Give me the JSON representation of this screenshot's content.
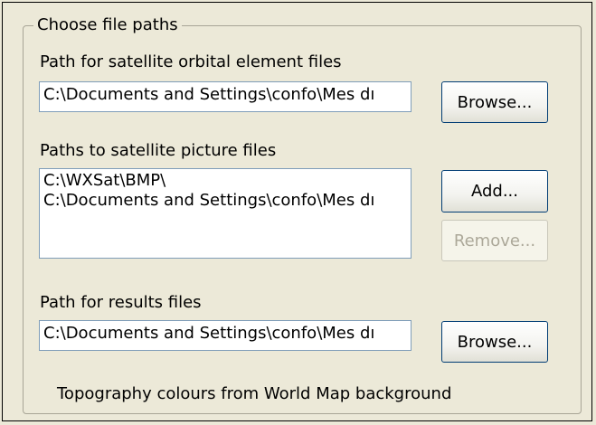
{
  "group_title": "Choose file paths",
  "orbital": {
    "label": "Path for satellite orbital element files",
    "value": "C:\\Documents and Settings\\confo\\Mes dı",
    "browse_label": "Browse..."
  },
  "pictures": {
    "label": "Paths to satellite picture files",
    "items": [
      "C:\\WXSat\\BMP\\",
      "C:\\Documents and Settings\\confo\\Mes dı"
    ],
    "add_label": "Add...",
    "remove_label": "Remove..."
  },
  "results": {
    "label": "Path for results files",
    "value": "C:\\Documents and Settings\\confo\\Mes dı",
    "browse_label": "Browse..."
  },
  "topography_text": "Topography colours from World Map background"
}
